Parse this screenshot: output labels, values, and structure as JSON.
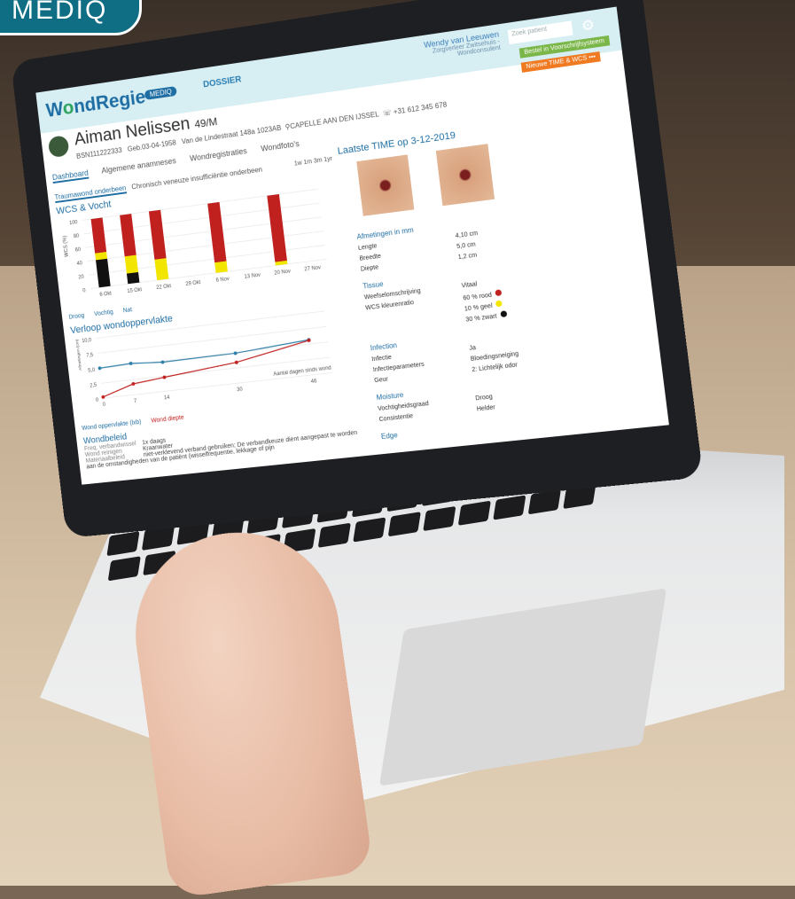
{
  "corner_logo": {
    "text": "MEDIQ"
  },
  "app": {
    "brand_prefix": "W",
    "brand_accent": "o",
    "brand_rest": "ndRegie",
    "brand_badge": "MEDIQ",
    "nav_dossier": "DOSSIER",
    "user_name": "Wendy van Leeuwen",
    "user_org": "Zorgverleer Zwitsehuis - Wondconsulent",
    "search_placeholder": "Zoek patient",
    "btn_order": "Bestel in Voorschrijfsysteem",
    "btn_new": "Nieuwe TIME & WCS",
    "btn_more": "•••"
  },
  "patient": {
    "name": "Aiman Nelissen",
    "age_gender": "49/M",
    "bsn": "BSN111222333",
    "dob": "Geb.03-04-1958",
    "address": "Van de Lindestraat 148a",
    "postcode": "1023AB",
    "city": "CAPELLE AAN DEN IJSSEL",
    "phone": "+31 612 345 678"
  },
  "tabs": [
    "Dashboard",
    "Algemene anamneses",
    "Wondregistraties",
    "Wondfoto's"
  ],
  "subtabs": [
    "Traumawond onderbeen",
    "Chronisch veneuze insufficiëntie onderbeen"
  ],
  "range_buttons": [
    "1w",
    "1m",
    "3m",
    "1yr"
  ],
  "chart1_title": "WCS & Vocht",
  "chart1_legend": [
    "Droog",
    "Vochtig",
    "Nat"
  ],
  "chart1_ylabel": "WCS (%)",
  "chart2_title": "Verloop wondoppervlakte",
  "chart2_ylabel": "Afmetingen (cm)",
  "chart2_xlabel": "Aantal dagen sinds wond",
  "chart2_legend": [
    "Wond oppervlakte (lxb)",
    "Wond diepte"
  ],
  "wondbeleid": {
    "title": "Wondbeleid",
    "rows": [
      {
        "k": "Freq. verbandwissel",
        "v": "1x daags"
      },
      {
        "k": "Wond reinigen",
        "v": "Kraanwater"
      },
      {
        "k": "Materiaalbeleid",
        "v": "niet-verklevend verband gebruiken; De verbandkeuze dient aangepast te worden aan de omstandigheden van de patiënt (wisselfrequentie, lekkage of pijn"
      }
    ]
  },
  "time_panel": {
    "title": "Laatste TIME op 3-12-2019",
    "afmetingen_title": "Afmetingen in mm",
    "afmetingen": [
      {
        "k": "Lengte",
        "v": "4,10",
        "u": "cm"
      },
      {
        "k": "Breedte",
        "v": "5,0",
        "u": "cm"
      },
      {
        "k": "Diepte",
        "v": "1,2",
        "u": "cm"
      }
    ],
    "tissue_title": "Tissue",
    "tissue": [
      {
        "k": "Weefselomschrijving",
        "v": "Vitaal"
      },
      {
        "k": "WCS kleurenratio",
        "v": "60 % rood"
      },
      {
        "k": "",
        "v": "10 % geel"
      },
      {
        "k": "",
        "v": "30 % zwart"
      }
    ],
    "infection_title": "Infection",
    "infection": [
      {
        "k": "Infectie",
        "v": "Ja"
      },
      {
        "k": "Infectieparameters",
        "v": "Bloedingsneiging"
      },
      {
        "k": "Geur",
        "v": "2: Lichtelijk odor"
      }
    ],
    "moisture_title": "Moisture",
    "moisture": [
      {
        "k": "Vochtigheidsgraad",
        "v": "Droog"
      },
      {
        "k": "Consistentie",
        "v": "Helder"
      }
    ],
    "edge_title": "Edge"
  },
  "colors": {
    "red": "#c0211f",
    "yellow": "#f2e600",
    "black": "#111111",
    "blue": "#1f6ea3",
    "line_blue": "#2e7fa8",
    "line_red": "#c0211f"
  },
  "chart_data": [
    {
      "type": "bar",
      "title": "WCS & Vocht",
      "ylabel": "WCS (%)",
      "categories": [
        "6 Okt",
        "15 Okt",
        "22 Okt",
        "29 Okt",
        "6 Nov",
        "13 Nov",
        "20 Nov",
        "27 Nov"
      ],
      "ylim": [
        0,
        100
      ],
      "yticks": [
        0,
        20,
        40,
        60,
        80,
        100
      ],
      "series": [
        {
          "name": "zwart",
          "values": [
            40,
            15,
            0,
            0,
            0,
            0,
            0,
            0
          ]
        },
        {
          "name": "geel",
          "values": [
            10,
            25,
            30,
            0,
            15,
            0,
            5,
            0
          ]
        },
        {
          "name": "rood",
          "values": [
            50,
            60,
            70,
            0,
            85,
            0,
            95,
            0
          ]
        }
      ]
    },
    {
      "type": "line",
      "title": "Verloop wondoppervlakte",
      "ylabel": "Afmetingen (cm)",
      "xlabel": "Aantal dagen sinds wond",
      "ylim": [
        0,
        10
      ],
      "yticks": [
        "0",
        "2,5",
        "5,0",
        "7,5",
        "10,0"
      ],
      "x": [
        0,
        7,
        14,
        30,
        46
      ],
      "series": [
        {
          "name": "Wond oppervlakte (lxb)",
          "values": [
            5.0,
            5.2,
            4.8,
            4.9,
            5.7
          ]
        },
        {
          "name": "Wond diepte",
          "values": [
            0.2,
            1.8,
            2.3,
            3.4,
            5.6
          ]
        }
      ]
    }
  ]
}
